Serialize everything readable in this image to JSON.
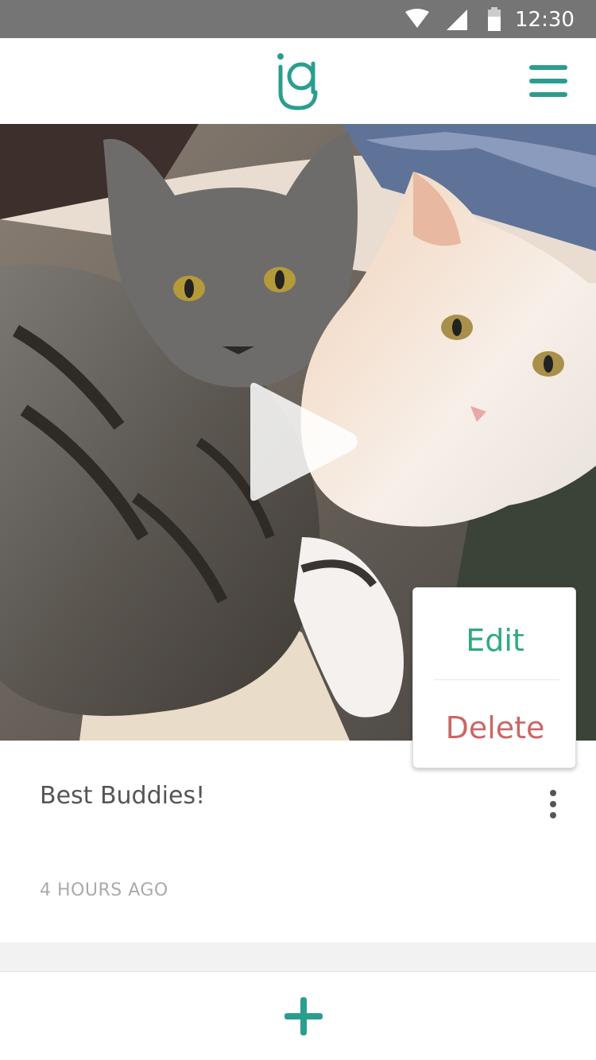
{
  "status_bar": {
    "time": "12:30",
    "icons": [
      "wifi-icon",
      "signal-icon",
      "battery-icon"
    ]
  },
  "app_bar": {
    "logo": "ig",
    "menu_icon": "hamburger-menu-icon"
  },
  "post": {
    "caption": "Best Buddies!",
    "timestamp": "4 HOURS AGO",
    "media_type": "video",
    "play_icon": "play-icon",
    "overflow_icon": "more-vert-icon"
  },
  "popup_menu": {
    "edit_label": "Edit",
    "delete_label": "Delete"
  },
  "bottom_bar": {
    "add_icon": "plus-icon"
  },
  "colors": {
    "accent": "#2b9d8f",
    "edit": "#2faa7e",
    "delete": "#cc6666",
    "status_bar": "#757575"
  }
}
